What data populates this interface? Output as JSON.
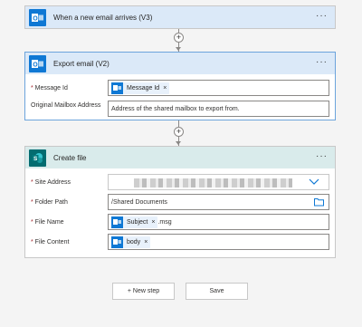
{
  "trigger": {
    "title": "When a new email arrives (V3)",
    "icon": "outlook-icon",
    "more": "···"
  },
  "export_step": {
    "title": "Export email (V2)",
    "icon": "outlook-icon",
    "more": "···",
    "fields": [
      {
        "label": "Message Id",
        "required": true,
        "token": "Message Id",
        "token_close": "×"
      },
      {
        "label": "Original Mailbox Address",
        "required": false,
        "placeholder": "Address of the shared mailbox to export from."
      }
    ]
  },
  "create_step": {
    "title": "Create file",
    "icon": "sharepoint-icon",
    "more": "···",
    "site_address_label": "Site Address",
    "folder_path_label": "Folder Path",
    "folder_path_value": "/Shared Documents",
    "file_name_label": "File Name",
    "file_name_token": "Subject",
    "file_name_token_close": "×",
    "file_name_suffix": ".msg",
    "file_content_label": "File Content",
    "file_content_token": "body",
    "file_content_token_close": "×"
  },
  "connector": {
    "plus": "+"
  },
  "actions": {
    "new_step": "+ New step",
    "save": "Save"
  },
  "colors": {
    "outlook_blue": "#0f78d4",
    "sharepoint_teal": "#036c70",
    "required_red": "#a4262c"
  }
}
